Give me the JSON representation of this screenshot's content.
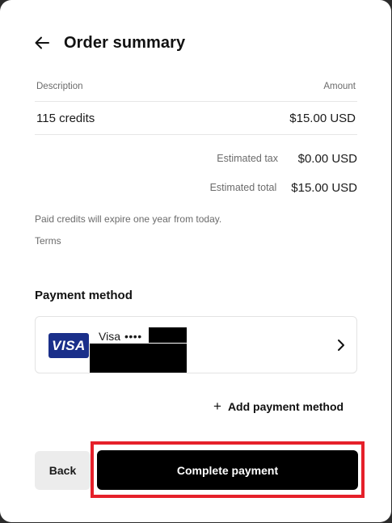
{
  "header": {
    "title": "Order summary",
    "back_icon": "arrow-left-icon"
  },
  "table": {
    "columns": [
      "Description",
      "Amount"
    ],
    "rows": [
      {
        "description": "115 credits",
        "amount": "$15.00 USD"
      }
    ]
  },
  "summary": {
    "tax_label": "Estimated tax",
    "tax_value": "$0.00 USD",
    "total_label": "Estimated total",
    "total_value": "$15.00 USD"
  },
  "note": "Paid credits will expire one year from today.",
  "terms_label": "Terms",
  "payment": {
    "section_title": "Payment method",
    "card_brand": "Visa",
    "card_mask": "••••",
    "logo_text": "VISA",
    "add_label": "Add payment method"
  },
  "buttons": {
    "back": "Back",
    "complete": "Complete payment"
  },
  "colors": {
    "highlight": "#e5202a",
    "visa_blue": "#1a2f8a",
    "primary_button": "#000000"
  }
}
